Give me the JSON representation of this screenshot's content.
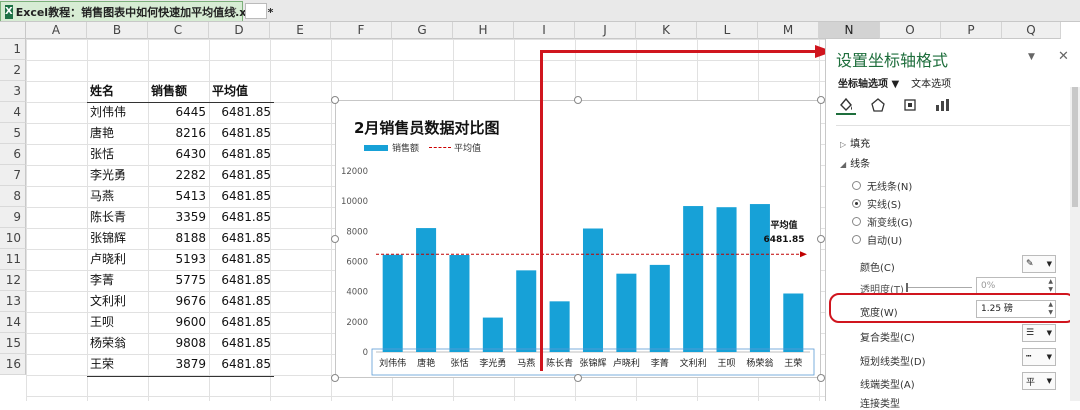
{
  "tab": {
    "app_icon_letter": "X",
    "title": "Excel教程：销售图表中如何快速加平均值线.xlsx *",
    "close": "×"
  },
  "columns": [
    "A",
    "B",
    "C",
    "D",
    "E",
    "F",
    "G",
    "H",
    "I",
    "J",
    "K",
    "L",
    "M",
    "N",
    "O",
    "P",
    "Q"
  ],
  "rows": [
    "1",
    "2",
    "3",
    "4",
    "5",
    "6",
    "7",
    "8",
    "9",
    "10",
    "11",
    "12",
    "13",
    "14",
    "15",
    "16"
  ],
  "table": {
    "headers": [
      "姓名",
      "销售额",
      "平均值"
    ],
    "rows": [
      [
        "刘伟伟",
        "6445",
        "6481.85"
      ],
      [
        "唐艳",
        "8216",
        "6481.85"
      ],
      [
        "张恬",
        "6430",
        "6481.85"
      ],
      [
        "李光勇",
        "2282",
        "6481.85"
      ],
      [
        "马燕",
        "5413",
        "6481.85"
      ],
      [
        "陈长青",
        "3359",
        "6481.85"
      ],
      [
        "张锦辉",
        "8188",
        "6481.85"
      ],
      [
        "卢晓利",
        "5193",
        "6481.85"
      ],
      [
        "李菁",
        "5775",
        "6481.85"
      ],
      [
        "文利利",
        "9676",
        "6481.85"
      ],
      [
        "王呗",
        "9600",
        "6481.85"
      ],
      [
        "杨荣翁",
        "9808",
        "6481.85"
      ],
      [
        "王荣",
        "3879",
        "6481.85"
      ]
    ]
  },
  "chart_data": {
    "type": "bar",
    "title": "2月销售员数据对比图",
    "categories": [
      "刘伟伟",
      "唐艳",
      "张恬",
      "李光勇",
      "马燕",
      "陈长青",
      "张锦辉",
      "卢晓利",
      "李菁",
      "文利利",
      "王呗",
      "杨荣翁",
      "王荣"
    ],
    "series": [
      {
        "name": "销售额",
        "values": [
          6445,
          8216,
          6430,
          2282,
          5413,
          3359,
          8188,
          5193,
          5775,
          9676,
          9600,
          9808,
          3879
        ],
        "color": "#17a1d7"
      },
      {
        "name": "平均值",
        "values": [
          6481.85,
          6481.85,
          6481.85,
          6481.85,
          6481.85,
          6481.85,
          6481.85,
          6481.85,
          6481.85,
          6481.85,
          6481.85,
          6481.85,
          6481.85
        ],
        "color": "#c00000",
        "style": "dashed-line"
      }
    ],
    "ylim": [
      0,
      12000
    ],
    "yticks": [
      "0",
      "2000",
      "4000",
      "6000",
      "8000",
      "10000",
      "12000"
    ],
    "annotation": {
      "label": "平均值",
      "value": "6481.85"
    },
    "legend_position": "top-left",
    "grid": false
  },
  "pane": {
    "title": "设置坐标轴格式",
    "dropdown_icon": "▼",
    "close": "✕",
    "tabs": [
      "坐标轴选项 ▼",
      "文本选项"
    ],
    "sections": {
      "fill": "填充",
      "line": "线条"
    },
    "radios": [
      "无线条(N)",
      "实线(S)",
      "渐变线(G)",
      "自动(U)"
    ],
    "selected_radio": "实线(S)",
    "props": {
      "color": "颜色(C)",
      "transparency": "透明度(T)",
      "transparency_value": "0%",
      "width": "宽度(W)",
      "width_value": "1.25 磅",
      "compound": "复合类型(C)",
      "dash": "短划线类型(D)",
      "cap": "线端类型(A)",
      "cap_value": "平",
      "join": "连接类型"
    },
    "colors": {
      "accent": "#1e6e3c",
      "highlight": "#d0151e"
    }
  }
}
